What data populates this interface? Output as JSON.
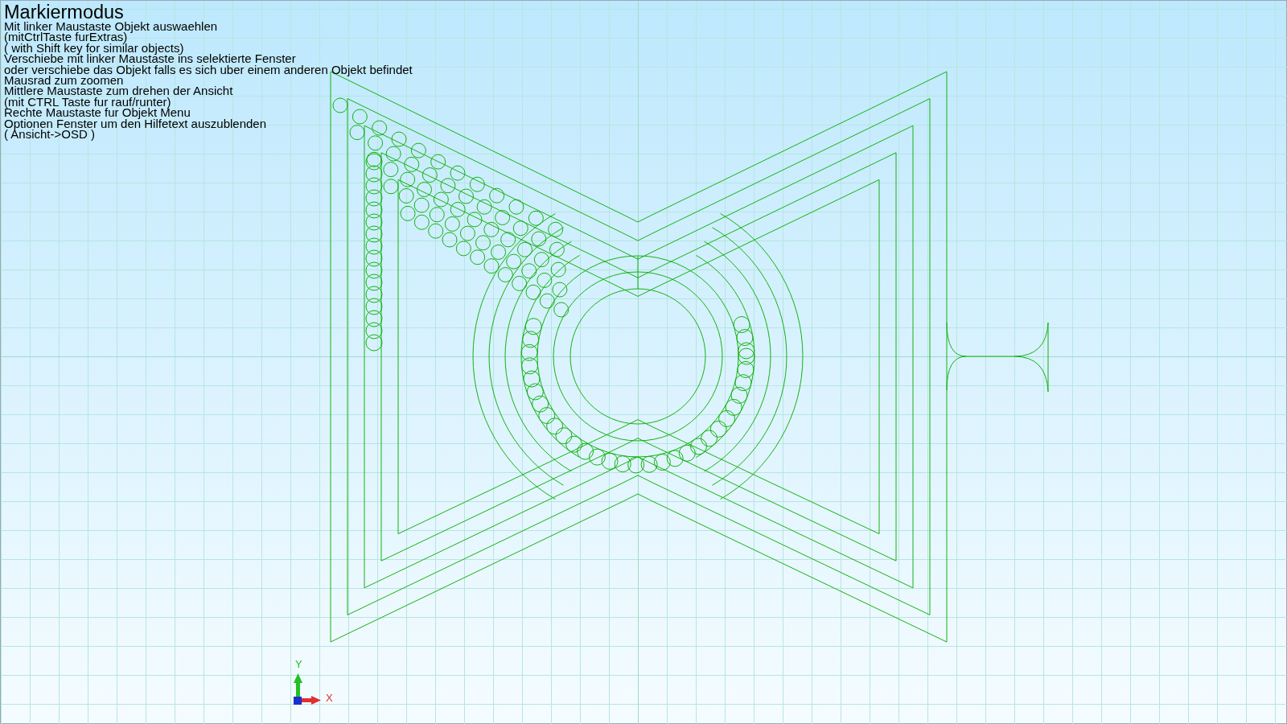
{
  "osd": {
    "title": "Markiermodus",
    "lines": [
      "Mit linker Maustaste Objekt auswaehlen",
      "(mitCtrlTaste furExtras)",
      "( with Shift key for similar objects)",
      "Verschiebe mit linker Maustaste ins selektierte Fenster",
      "oder verschiebe das Objekt falls es sich uber einem anderen Objekt befindet",
      "Mausrad zum zoomen",
      "Mittlere Maustaste zum drehen der Ansicht",
      "(mit CTRL Taste fur rauf/runter)",
      "Rechte Maustaste fur Objekt Menu",
      "Optionen Fenster um den Hilfetext auszublenden",
      "( Ansicht->OSD )"
    ]
  },
  "axes": {
    "y_label": "Y",
    "x_label": "X"
  }
}
